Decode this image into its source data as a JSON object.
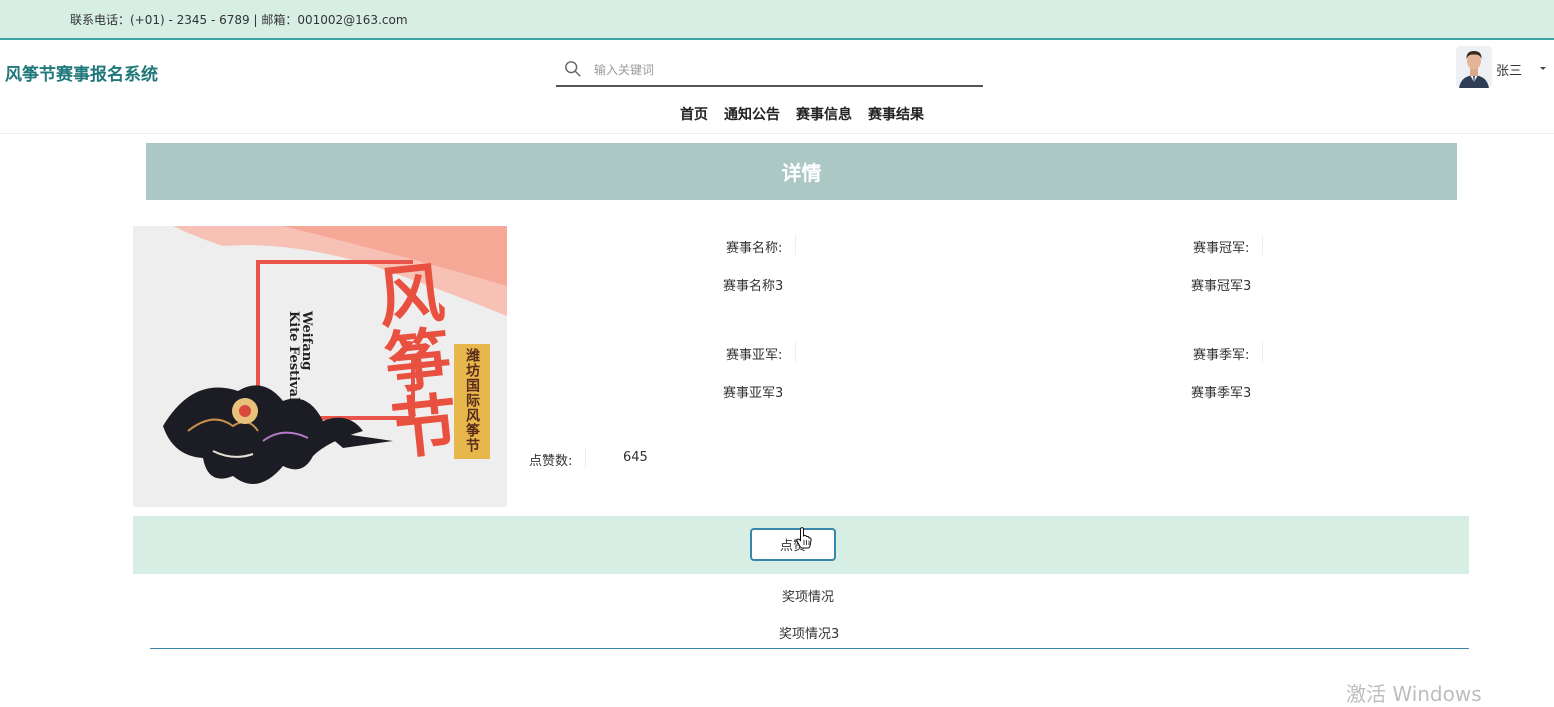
{
  "topbar": {
    "contact": "联系电话：(+01) - 2345 - 6789 | 邮箱：001002@163.com"
  },
  "header": {
    "logo": "风筝节赛事报名系统",
    "search_placeholder": "输入关键词",
    "user_name": "张三"
  },
  "nav": {
    "home": "首页",
    "notice": "通知公告",
    "event_info": "赛事信息",
    "event_result": "赛事结果"
  },
  "detail": {
    "banner_title": "详情",
    "poster": {
      "title_art": "风筝节",
      "en_line1": "Weifang",
      "en_line2": "Kite Festival",
      "vertical_text": "潍坊国际风筝节"
    },
    "fields": {
      "name_label": "赛事名称:",
      "name_value": "赛事名称3",
      "champion_label": "赛事冠军:",
      "champion_value": "赛事冠军3",
      "runnerup_label": "赛事亚军:",
      "runnerup_value": "赛事亚军3",
      "third_label": "赛事季军:",
      "third_value": "赛事季军3",
      "likes_label": "点赞数:",
      "likes_value": "645"
    },
    "like_button": "点赞",
    "award_label": "奖项情况",
    "award_value": "奖项情况3"
  },
  "watermark": "激活 Windows",
  "colors": {
    "topbar_bg": "#d7eee4",
    "accent": "#3aa5a0",
    "logo": "#20787a",
    "banner_bg": "#acc8c5"
  }
}
